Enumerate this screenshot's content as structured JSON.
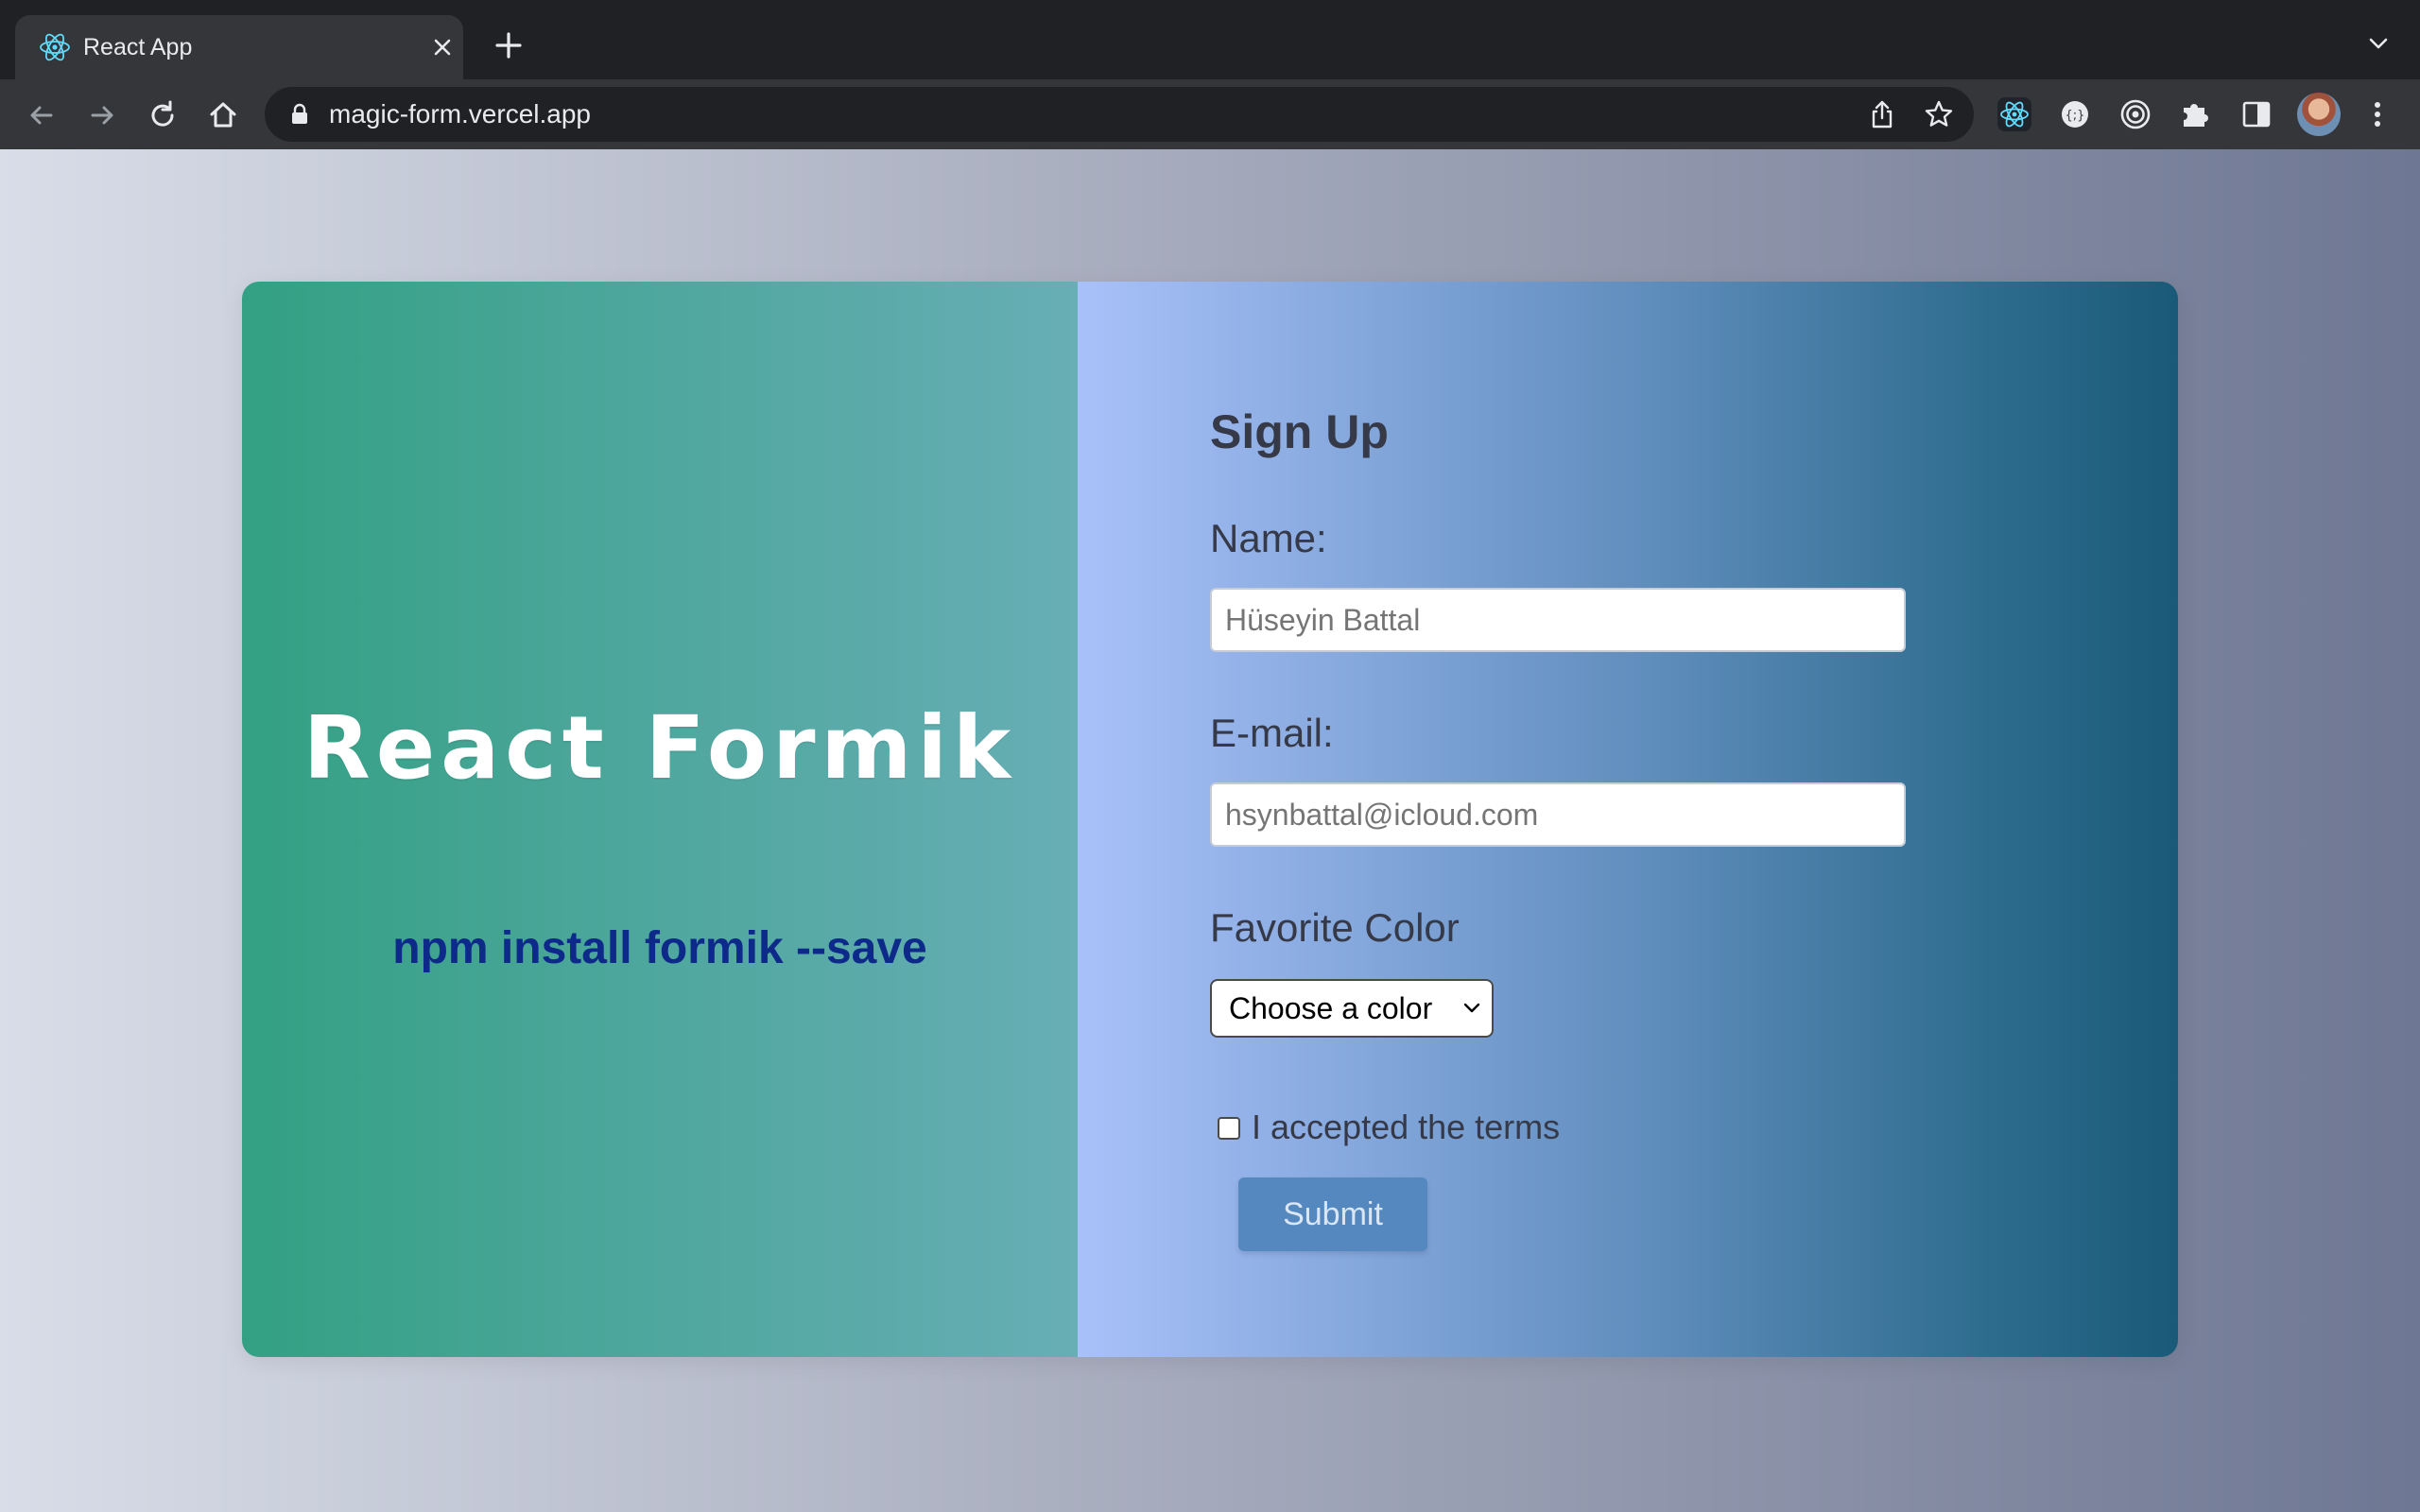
{
  "browser": {
    "tab": {
      "title": "React App",
      "favicon": "react-icon"
    },
    "url": "magic-form.vercel.app",
    "icons": [
      "back-icon",
      "forward-icon",
      "reload-icon",
      "home-icon",
      "lock-icon",
      "share-icon",
      "star-icon",
      "react-devtools-icon",
      "extension-icon",
      "target-icon",
      "puzzle-icon",
      "side-panel-icon",
      "profile-avatar",
      "kebab-menu-icon"
    ]
  },
  "left": {
    "title": "React Formik",
    "install_cmd": "npm install formik --save"
  },
  "form": {
    "title": "Sign Up",
    "name_label": "Name:",
    "name_placeholder": "Hüseyin Battal",
    "email_label": "E-mail:",
    "email_placeholder": "hsynbattal@icloud.com",
    "color_label": "Favorite Color",
    "color_selected": "Choose a color",
    "terms_label": "I accepted the terms",
    "submit_label": "Submit"
  },
  "colors": {
    "left_gradient": [
      "#33a083",
      "#67aeb5"
    ],
    "right_gradient": [
      "#a9c1fa",
      "#1a5a78"
    ],
    "install_cmd": "#0d2a8a",
    "submit_bg": "#5688c0"
  }
}
